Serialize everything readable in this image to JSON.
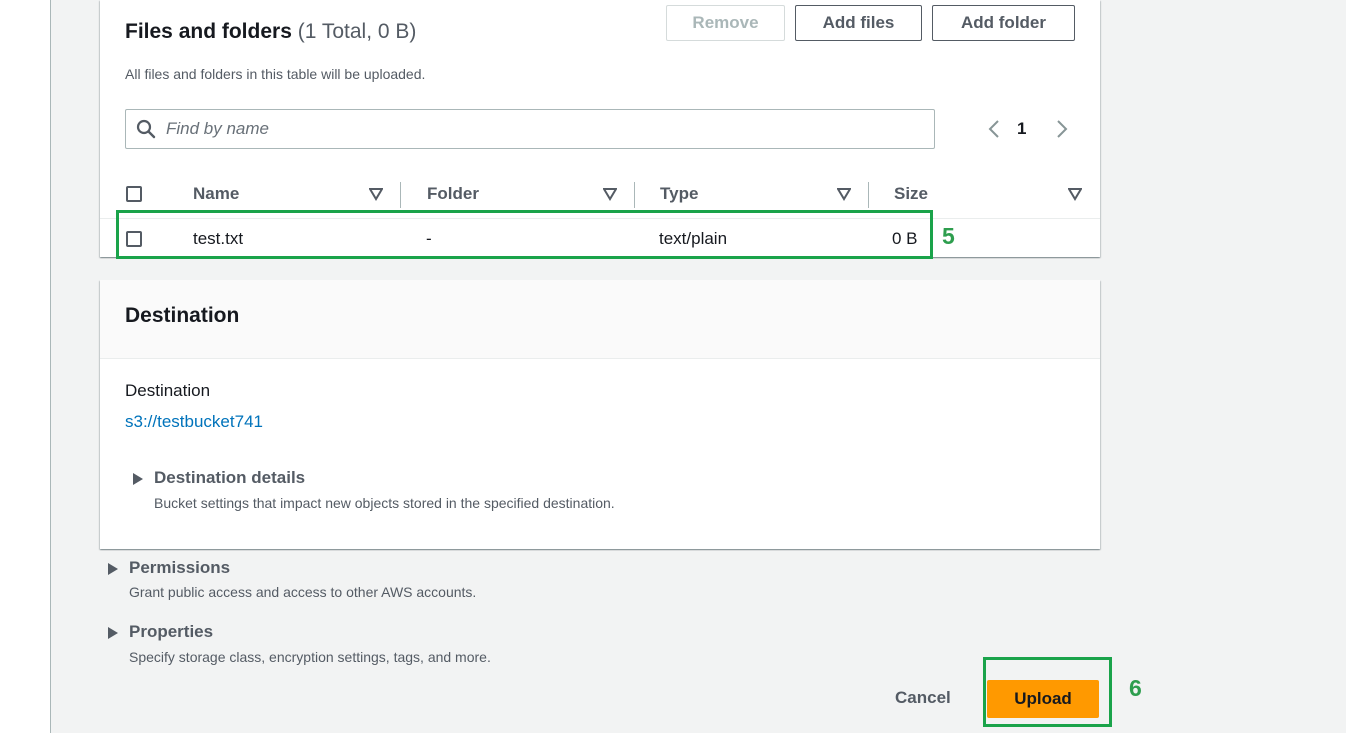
{
  "files_section": {
    "title": "Files and folders",
    "count": "(1 Total, 0 B)",
    "description": "All files and folders in this table will be uploaded.",
    "buttons": {
      "remove": "Remove",
      "add_files": "Add files",
      "add_folder": "Add folder"
    },
    "search": {
      "placeholder": "Find by name",
      "value": ""
    },
    "pagination": {
      "current_page": "1"
    },
    "columns": [
      "Name",
      "Folder",
      "Type",
      "Size"
    ],
    "rows": [
      {
        "name": "test.txt",
        "folder": "-",
        "type": "text/plain",
        "size": "0 B"
      }
    ]
  },
  "destination_section": {
    "title": "Destination",
    "label": "Destination",
    "value": "s3://testbucket741",
    "details": {
      "title": "Destination details",
      "description": "Bucket settings that impact new objects stored in the specified destination."
    }
  },
  "permissions": {
    "title": "Permissions",
    "description": "Grant public access and access to other AWS accounts."
  },
  "properties": {
    "title": "Properties",
    "description": "Specify storage class, encryption settings, tags, and more."
  },
  "footer": {
    "cancel": "Cancel",
    "upload": "Upload"
  },
  "annotations": {
    "row_marker": "5",
    "upload_marker": "6"
  },
  "colors": {
    "primary": "#ff9900",
    "link": "#0073bb",
    "annotation": "#1aa34a"
  },
  "icons": [
    "search-icon",
    "chevron-left-icon",
    "chevron-right-icon",
    "sort-down-icon",
    "caret-right-icon"
  ]
}
